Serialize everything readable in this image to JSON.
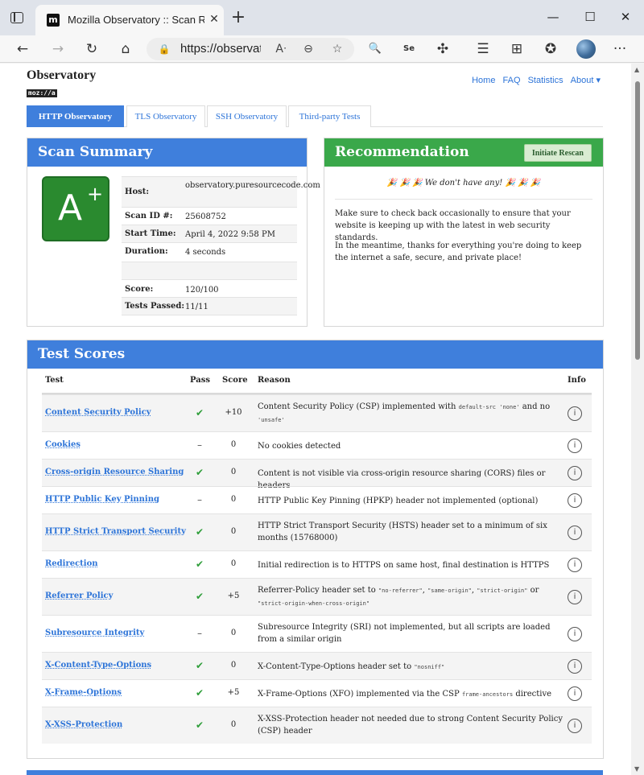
{
  "browser": {
    "tab_title": "Mozilla Observatory :: Scan Results",
    "favicon_letter": "m",
    "url": "https://observatory.mozilla.org",
    "new_tab": "+",
    "close_tab": "✕",
    "window_controls": {
      "minimize": "—",
      "maximize": "☐",
      "close": "✕"
    },
    "toolbar_icons": {
      "back": "←",
      "forward": "→",
      "refresh": "↻",
      "home": "⌂",
      "read_aloud": "Aᐧ",
      "zoom": "⊖",
      "favorite": "☆",
      "search": "🔍",
      "extension_se": "Se",
      "extensions": "✣",
      "favorites": "☰",
      "collections": "⊞",
      "shield": "✪",
      "more": "···"
    }
  },
  "site": {
    "brand": "Observatory",
    "brand_badge": "moz://a",
    "nav": [
      "Home",
      "FAQ",
      "Statistics",
      "About ▾"
    ],
    "subtabs": [
      "HTTP Observatory",
      "TLS Observatory",
      "SSH Observatory",
      "Third-party Tests"
    ]
  },
  "summary": {
    "title": "Scan Summary",
    "grade": "A",
    "grade_modifier": "+",
    "rows": [
      {
        "key": "Host:",
        "value": "observatory.puresourcecode.com"
      },
      {
        "key": "Scan ID #:",
        "value": "25608752"
      },
      {
        "key": "Start Time:",
        "value": "April 4, 2022 9:58 PM"
      },
      {
        "key": "Duration:",
        "value": "4 seconds"
      },
      {
        "key": "",
        "value": ""
      },
      {
        "key": "Score:",
        "value": "120/100"
      },
      {
        "key": "Tests Passed:",
        "value": "11/11"
      }
    ]
  },
  "recommendation": {
    "title": "Recommendation",
    "button": "Initiate Rescan",
    "headline": "🎉 🎉 🎉  We don't have any!  🎉 🎉 🎉",
    "para1": "Make sure to check back occasionally to ensure that your website is keeping up with the latest in web security standards.",
    "para2": "In the meantime, thanks for everything you're doing to keep the internet a safe, secure, and private place!"
  },
  "tests": {
    "title": "Test Scores",
    "headers": {
      "test": "Test",
      "pass": "Pass",
      "score": "Score",
      "reason": "Reason",
      "info": "Info"
    },
    "rows": [
      {
        "test": "Content Security Policy",
        "pass": "✔",
        "score": "+10",
        "reason": "Content Security Policy (CSP) implemented with <code>default-src 'none'</code> and no <code>'unsafe'</code>"
      },
      {
        "test": "Cookies",
        "pass": "–",
        "score": "0",
        "reason": "No cookies detected"
      },
      {
        "test": "Cross-origin Resource Sharing",
        "pass": "✔",
        "score": "0",
        "reason": "Content is not visible via cross-origin resource sharing (CORS) files or headers"
      },
      {
        "test": "HTTP Public Key Pinning",
        "pass": "–",
        "score": "0",
        "reason": "HTTP Public Key Pinning (HPKP) header not implemented (optional)"
      },
      {
        "test": "HTTP Strict Transport Security",
        "pass": "✔",
        "score": "0",
        "reason": "HTTP Strict Transport Security (HSTS) header set to a minimum of six months (15768000)"
      },
      {
        "test": "Redirection",
        "pass": "✔",
        "score": "0",
        "reason": "Initial redirection is to HTTPS on same host, final destination is HTTPS"
      },
      {
        "test": "Referrer Policy",
        "pass": "✔",
        "score": "+5",
        "reason": "Referrer-Policy header set to <code>\"no-referrer\"</code>, <code>\"same-origin\"</code>, <code>\"strict-origin\"</code> or <code>\"strict-origin-when-cross-origin\"</code>"
      },
      {
        "test": "Subresource Integrity",
        "pass": "–",
        "score": "0",
        "reason": "Subresource Integrity (SRI) not implemented, but all scripts are loaded from a similar origin"
      },
      {
        "test": "X-Content-Type-Options",
        "pass": "✔",
        "score": "0",
        "reason": "X-Content-Type-Options header set to <code>\"nosniff\"</code>"
      },
      {
        "test": "X-Frame-Options",
        "pass": "✔",
        "score": "+5",
        "reason": "X-Frame-Options (XFO) implemented via the CSP <code>frame-ancestors</code> directive"
      },
      {
        "test": "X-XSS-Protection",
        "pass": "✔",
        "score": "0",
        "reason": "X-XSS-Protection header not needed due to strong Content Security Policy (CSP) header"
      }
    ]
  },
  "info_icon": "i",
  "colors": {
    "accent_blue": "#3f7fdc",
    "accent_green": "#3aa84a",
    "grade_green": "#2a8a2f",
    "link": "#2d74d8"
  }
}
